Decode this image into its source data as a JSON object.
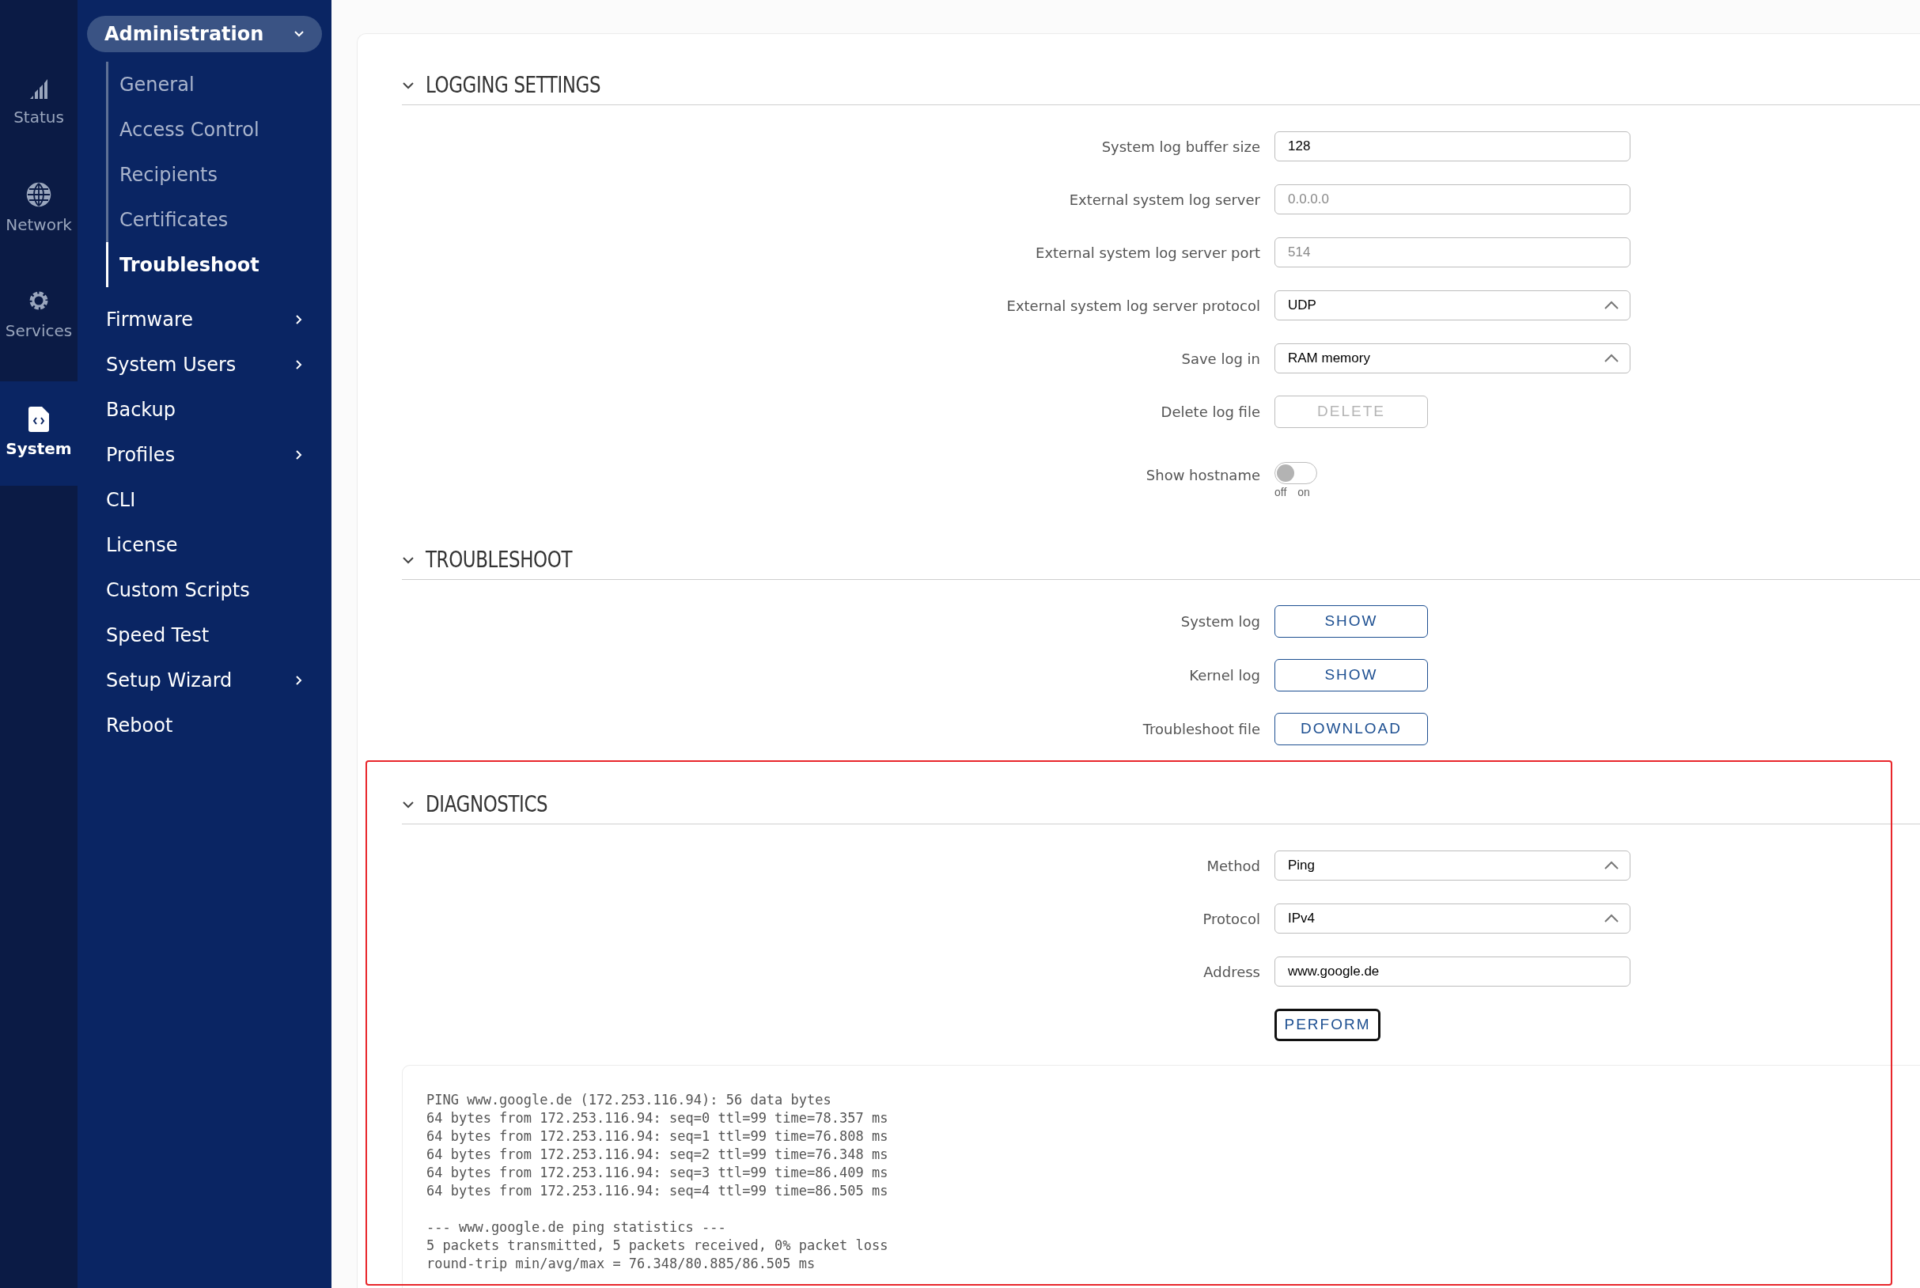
{
  "rail": [
    {
      "label": "Status",
      "selected": false
    },
    {
      "label": "Network",
      "selected": false
    },
    {
      "label": "Services",
      "selected": false
    },
    {
      "label": "System",
      "selected": true
    }
  ],
  "nav": {
    "group": {
      "label": "Administration",
      "expanded": true,
      "children": [
        {
          "label": "General",
          "selected": false
        },
        {
          "label": "Access Control",
          "selected": false
        },
        {
          "label": "Recipients",
          "selected": false
        },
        {
          "label": "Certificates",
          "selected": false
        },
        {
          "label": "Troubleshoot",
          "selected": true
        }
      ]
    },
    "items": [
      {
        "label": "Firmware",
        "has_submenu": true
      },
      {
        "label": "System Users",
        "has_submenu": true
      },
      {
        "label": "Backup",
        "has_submenu": false
      },
      {
        "label": "Profiles",
        "has_submenu": true
      },
      {
        "label": "CLI",
        "has_submenu": false
      },
      {
        "label": "License",
        "has_submenu": false
      },
      {
        "label": "Custom Scripts",
        "has_submenu": false
      },
      {
        "label": "Speed Test",
        "has_submenu": false
      },
      {
        "label": "Setup Wizard",
        "has_submenu": true
      },
      {
        "label": "Reboot",
        "has_submenu": false
      }
    ]
  },
  "sections": [
    {
      "title": "LOGGING SETTINGS",
      "expanded": true,
      "highlighted": false,
      "rows": [
        {
          "kind": "text",
          "label": "System log buffer size",
          "value": "128"
        },
        {
          "kind": "text",
          "label": "External system log server",
          "placeholder": "0.0.0.0"
        },
        {
          "kind": "text",
          "label": "External system log server port",
          "placeholder": "514"
        },
        {
          "kind": "select",
          "label": "External system log server protocol",
          "value": "UDP"
        },
        {
          "kind": "select",
          "label": "Save log in",
          "value": "RAM memory"
        },
        {
          "kind": "button",
          "label": "Delete log file",
          "button": "DELETE",
          "disabled": true,
          "focused": false
        },
        {
          "kind": "toggle",
          "label": "Show hostname",
          "on": false,
          "off_label": "off",
          "on_label": "on"
        }
      ]
    },
    {
      "title": "TROUBLESHOOT",
      "expanded": true,
      "highlighted": false,
      "rows": [
        {
          "kind": "button",
          "label": "System log",
          "button": "SHOW",
          "disabled": false,
          "focused": false
        },
        {
          "kind": "button",
          "label": "Kernel log",
          "button": "SHOW",
          "disabled": false,
          "focused": false
        },
        {
          "kind": "button",
          "label": "Troubleshoot file",
          "button": "DOWNLOAD",
          "disabled": false,
          "focused": false
        }
      ]
    },
    {
      "title": "DIAGNOSTICS",
      "expanded": true,
      "highlighted": true,
      "rows": [
        {
          "kind": "select",
          "label": "Method",
          "value": "Ping"
        },
        {
          "kind": "select",
          "label": "Protocol",
          "value": "IPv4"
        },
        {
          "kind": "text",
          "label": "Address",
          "value": "www.google.de"
        },
        {
          "kind": "button",
          "button": "PERFORM",
          "disabled": false,
          "focused": true
        }
      ],
      "output": [
        [
          "PING www.google.de (172.253.116.94): 56 data bytes",
          "64 bytes from 172.253.116.94: seq=0 ttl=99 time=78.357 ms",
          "64 bytes from 172.253.116.94: seq=1 ttl=99 time=76.808 ms",
          "64 bytes from 172.253.116.94: seq=2 ttl=99 time=76.348 ms",
          "64 bytes from 172.253.116.94: seq=3 ttl=99 time=86.409 ms",
          "64 bytes from 172.253.116.94: seq=4 ttl=99 time=86.505 ms"
        ],
        [
          "--- www.google.de ping statistics ---",
          "5 packets transmitted, 5 packets received, 0% packet loss",
          "round-trip min/avg/max = 76.348/80.885/86.505 ms"
        ]
      ]
    }
  ]
}
